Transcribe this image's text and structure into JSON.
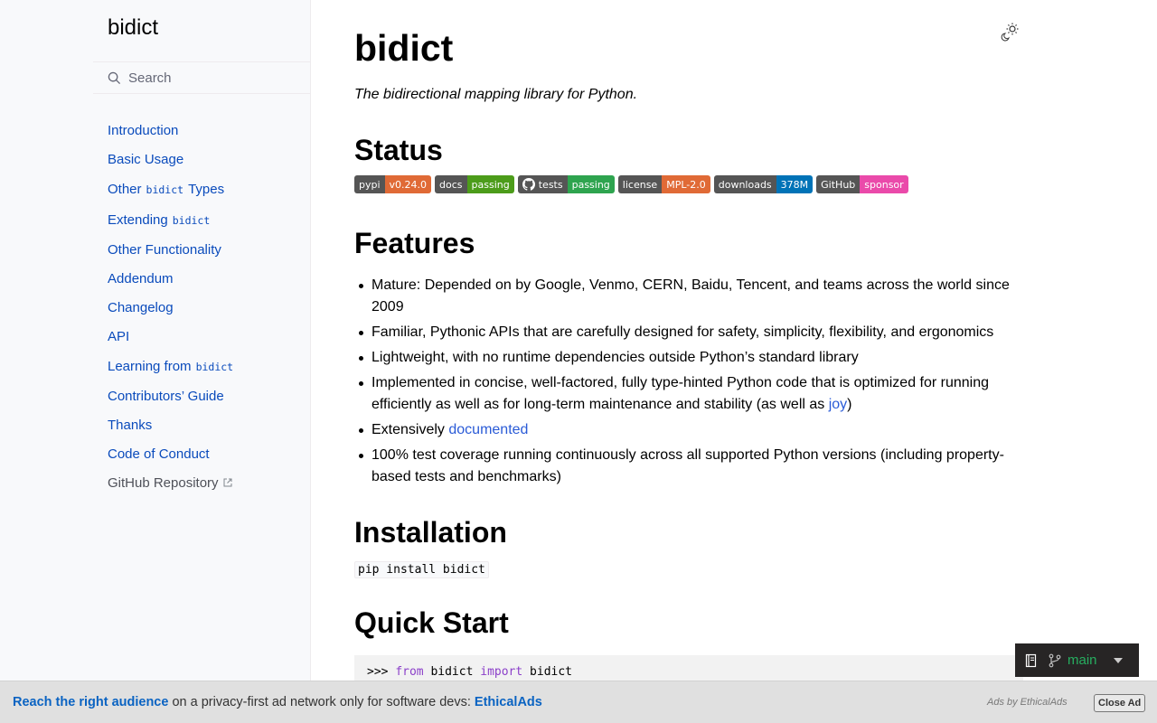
{
  "sidebar": {
    "brand": "bidict",
    "search_placeholder": "Search",
    "items": [
      {
        "label": "Introduction"
      },
      {
        "label": "Basic Usage"
      },
      {
        "pre": "Other",
        "code": "bidict",
        "post": "Types"
      },
      {
        "pre": "Extending",
        "code": "bidict"
      },
      {
        "label": "Other Functionality"
      },
      {
        "label": "Addendum"
      },
      {
        "label": "Changelog"
      },
      {
        "label": "API"
      },
      {
        "pre": "Learning from",
        "code": "bidict"
      },
      {
        "label": "Contributors’ Guide"
      },
      {
        "label": "Thanks"
      },
      {
        "label": "Code of Conduct"
      },
      {
        "label": "GitHub Repository"
      }
    ]
  },
  "main": {
    "title": "bidict",
    "tagline": "The bidirectional mapping library for Python.",
    "status_heading": "Status",
    "badges": [
      {
        "label": "pypi",
        "value": "v0.24.0",
        "color": "#e05d44"
      },
      {
        "label": "docs",
        "value": "passing",
        "color": "#4c1"
      },
      {
        "label": "tests",
        "value": "passing",
        "color": "#2ea44f"
      },
      {
        "label": "license",
        "value": "MPL-2.0",
        "color": "#e05d44"
      },
      {
        "label": "downloads",
        "value": "378M",
        "color": "#007ec6"
      },
      {
        "label": "GitHub",
        "value": "sponsor",
        "color": "#ea4aaa"
      }
    ],
    "features_heading": "Features",
    "features": [
      {
        "text": "Mature: Depended on by Google, Venmo, CERN, Baidu, Tencent, and teams across the world since 2009"
      },
      {
        "text": "Familiar, Pythonic APIs that are carefully designed for safety, simplicity, flexibility, and ergonomics"
      },
      {
        "text": "Lightweight, with no runtime dependencies outside Python’s standard library"
      },
      {
        "text": "Implemented in concise, well-factored, fully type-hinted Python code that is optimized for running efficiently as well as for long-term maintenance and stability (as well as ",
        "link": "joy",
        "after": ")"
      },
      {
        "text": "Extensively ",
        "link": "documented",
        "after": ""
      },
      {
        "text": "100% test coverage running continuously across all supported Python versions (including property-based tests and benchmarks)"
      }
    ],
    "installation_heading": "Installation",
    "install_cmd": "pip install bidict",
    "quickstart_heading": "Quick Start",
    "code": {
      "prompt": ">>>",
      "kw1": "from",
      "mod": "bidict",
      "kw2": "import",
      "name": "bidict"
    }
  },
  "rtd": {
    "version": "main"
  },
  "ad": {
    "headline": "Reach the right audience",
    "text": " on a privacy-first ad network only for software devs: ",
    "brand": "EthicalAds",
    "by": "Ads by EthicalAds",
    "close": "Close Ad"
  }
}
